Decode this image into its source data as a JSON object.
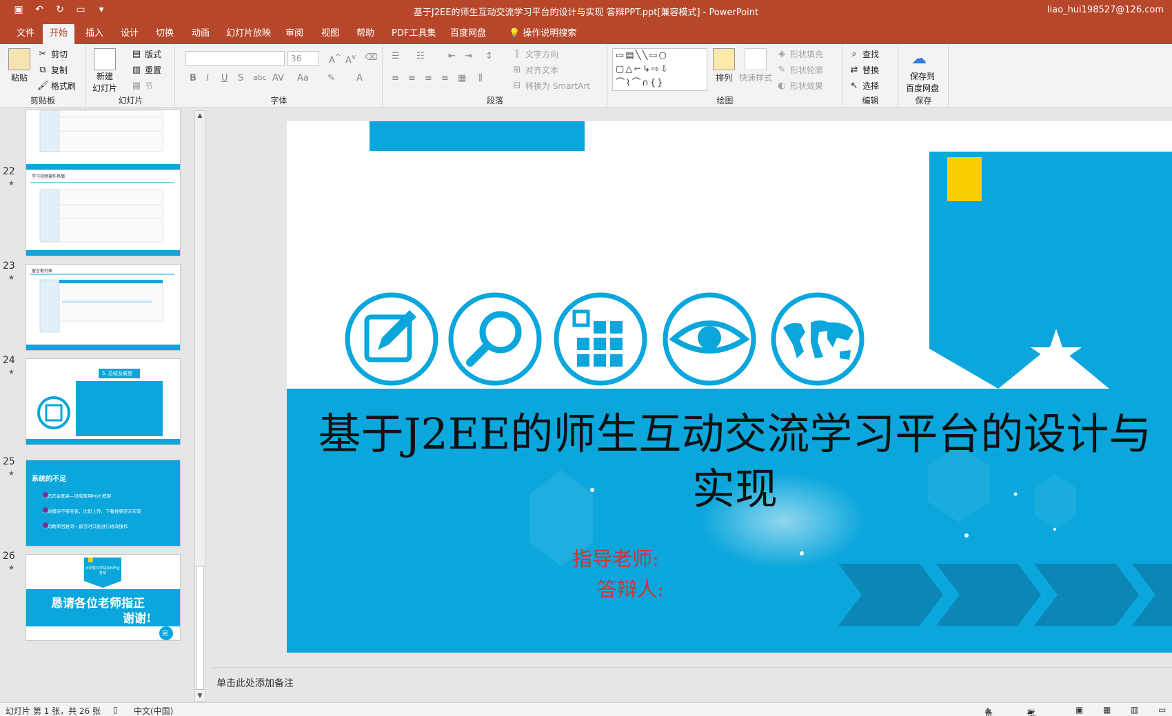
{
  "window": {
    "title": "基于J2EE的师生互动交流学习平台的设计与实现 答辩PPT.ppt[兼容模式]  -  PowerPoint",
    "user": "liao_hui198527@126.com"
  },
  "tabs": [
    "文件",
    "开始",
    "插入",
    "设计",
    "切换",
    "动画",
    "幻灯片放映",
    "审阅",
    "视图",
    "帮助",
    "PDF工具集",
    "百度网盘"
  ],
  "tell_me": "操作说明搜索",
  "ribbon": {
    "clipboard": {
      "name": "剪贴板",
      "paste": "粘贴",
      "cut": "剪切",
      "copy": "复制",
      "format_painter": "格式刷"
    },
    "slides": {
      "name": "幻灯片",
      "new_slide_1": "新建",
      "new_slide_2": "幻灯片",
      "layout": "版式",
      "reset": "重置",
      "section": "节"
    },
    "font": {
      "name": "字体",
      "size": "36"
    },
    "paragraph": {
      "name": "段落",
      "text_direction": "文字方向",
      "align_text": "对齐文本",
      "smartart": "转换为 SmartArt"
    },
    "drawing": {
      "name": "绘图",
      "arrange": "排列",
      "quick_styles": "快速样式",
      "fill": "形状填充",
      "outline": "形状轮廓",
      "effects": "形状效果"
    },
    "editing": {
      "name": "编辑",
      "find": "查找",
      "replace": "替换",
      "select": "选择"
    },
    "save": {
      "name": "保存",
      "label_1": "保存到",
      "label_2": "百度网盘"
    }
  },
  "thumbnails": [
    {
      "num": "22",
      "caption": "学习视频操作界面"
    },
    {
      "num": "23",
      "caption": "留言板列表"
    },
    {
      "num": "24",
      "caption": "5. 总结及展望"
    },
    {
      "num": "25",
      "title": "系统的不足",
      "items": [
        "代码冗余度高—没有使用MVC框架",
        "功能模块不够完善，比如上传、下载视频还未实现",
        "不同教师回复同一留言时只能进行修改操作"
      ]
    },
    {
      "num": "26",
      "badge": "大学软件学院本科毕业答辩",
      "line1": "恳请各位老师指正",
      "line2": "谢谢!",
      "circle": "完"
    }
  ],
  "slide": {
    "title": "基于J2EE的师生互动交流学习平台的设计与实现",
    "advisor": "指导老师:",
    "presenter": "答辩人:",
    "colors": {
      "blue": "#0aa6dc",
      "dark_blue": "#0b86b5",
      "yellow": "#fcd000",
      "red": "#c83737"
    }
  },
  "notes_placeholder": "单击此处添加备注",
  "status": {
    "slide_info": "幻灯片 第 1 张，共 26 张",
    "language": "中文(中国)",
    "notes": "备注",
    "comments": "批注"
  }
}
